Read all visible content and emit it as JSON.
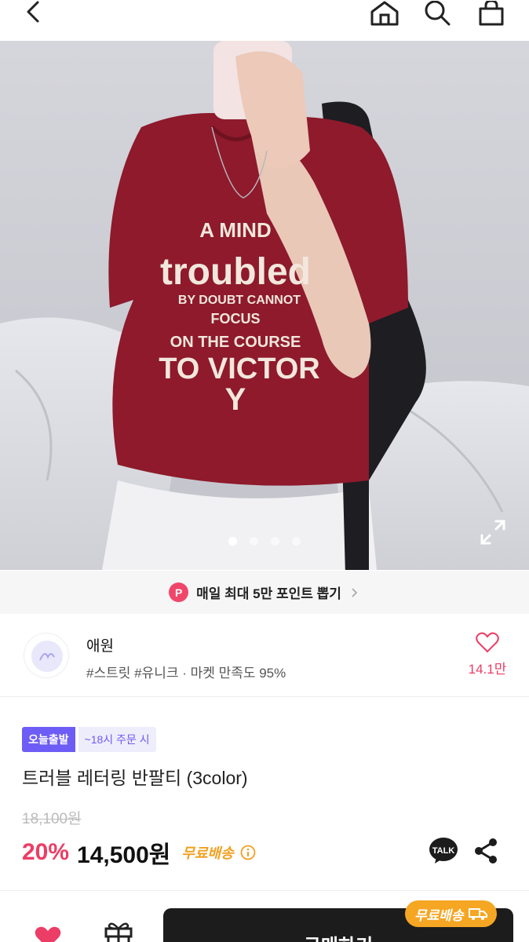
{
  "header": {
    "icons": [
      "back-arrow-icon",
      "home-icon",
      "search-icon",
      "shopping-bag-icon"
    ]
  },
  "photo": {
    "alt": "red t-shirt mirror selfie",
    "shirt_print_lines": [
      "A MIND",
      "troubled",
      "BY DOUBT CANNOT",
      "FOCUS",
      "ON THE COURSE",
      "TO VICTOR",
      "Y"
    ],
    "image_count": 4,
    "active_index": 0
  },
  "points_banner": {
    "badge": "P",
    "text": "매일 최대 5만 포인트 뽑기"
  },
  "store": {
    "name": "애원",
    "tags": "#스트릿 #유니크 · 마켓 만족도 95%",
    "like_count": "14.1만"
  },
  "product": {
    "badge_today": "오늘출발",
    "badge_order": "~18시 주문 시",
    "title": "트러블 레터링 반팔티 (3color)",
    "original_price": "18,100원",
    "discount": "20%",
    "price": "14,500원",
    "free_shipping": "무료배송"
  },
  "bottom": {
    "buy_label": "구매하기",
    "bubble": "무료배송"
  },
  "colors": {
    "accent_pink": "#ec3d66",
    "purple": "#6d5cf5",
    "orange": "#f5a623",
    "shirt_red": "#8e1a2c"
  }
}
